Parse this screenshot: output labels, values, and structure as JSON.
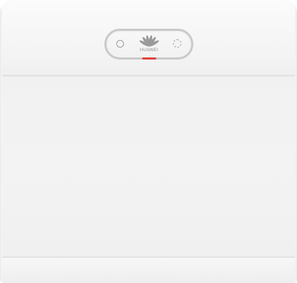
{
  "device": {
    "brand_text": "HUAWEI",
    "logo_icon": "huawei-petal-logo-icon",
    "colors": {
      "body": "#f3f3f3",
      "panel_border": "#c9c9c9",
      "status_led": "#e0433a"
    }
  }
}
